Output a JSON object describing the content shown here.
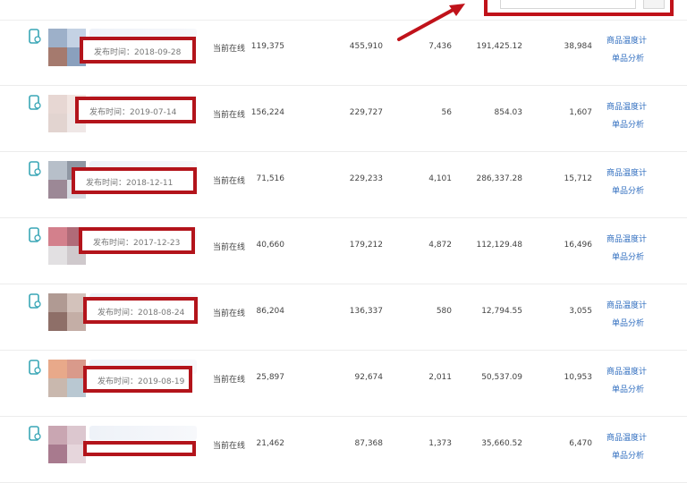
{
  "search": {
    "placeholder": "",
    "button_icon": "search-icon"
  },
  "colors": {
    "highlight": "#c0121a",
    "link": "#2f6dbf"
  },
  "rows": [
    {
      "date_label": "发布时间：2018-09-28",
      "status": "当前在线",
      "v1": "119,375",
      "v2": "455,910",
      "v3": "7,436",
      "v4": "191,425.12",
      "v5": "38,984",
      "link1": "商品温度计",
      "link2": "单品分析",
      "thumb": [
        "#9db0c9",
        "#c4d2e4",
        "#a57a6e",
        "#8aa0bd"
      ]
    },
    {
      "date_label": "发布时间：2019-07-14",
      "status": "当前在线",
      "v1": "156,224",
      "v2": "229,727",
      "v3": "56",
      "v4": "854.03",
      "v5": "1,607",
      "link1": "商品温度计",
      "link2": "单品分析",
      "thumb": [
        "#e7d7d3",
        "#f2e6e2",
        "#e2d4d0",
        "#efe7e6"
      ]
    },
    {
      "date_label": "发布时间：2018-12-11",
      "status": "当前在线",
      "v1": "71,516",
      "v2": "229,233",
      "v3": "4,101",
      "v4": "286,337.28",
      "v5": "15,712",
      "link1": "商品温度计",
      "link2": "单品分析",
      "thumb": [
        "#b7bfc9",
        "#8f97a3",
        "#9c8896",
        "#d8dbe2"
      ]
    },
    {
      "date_label": "发布时间：2017-12-23",
      "status": "当前在线",
      "v1": "40,660",
      "v2": "179,212",
      "v3": "4,872",
      "v4": "112,129.48",
      "v5": "16,496",
      "link1": "商品温度计",
      "link2": "单品分析",
      "thumb": [
        "#d3808c",
        "#b06b78",
        "#e2e0e2",
        "#cfc9cc"
      ]
    },
    {
      "date_label": "发布时间：2018-08-24",
      "status": "当前在线",
      "v1": "86,204",
      "v2": "136,337",
      "v3": "580",
      "v4": "12,794.55",
      "v5": "3,055",
      "link1": "商品温度计",
      "link2": "单品分析",
      "thumb": [
        "#b09a93",
        "#d3c2bb",
        "#8e6f68",
        "#c4aea6"
      ]
    },
    {
      "date_label": "发布时间：2019-08-19",
      "status": "当前在线",
      "v1": "25,897",
      "v2": "92,674",
      "v3": "2,011",
      "v4": "50,537.09",
      "v5": "10,953",
      "link1": "商品温度计",
      "link2": "单品分析",
      "thumb": [
        "#e8a98a",
        "#d99a8b",
        "#c9b8ae",
        "#b9c8d2"
      ]
    },
    {
      "date_label": "",
      "status": "当前在线",
      "v1": "21,462",
      "v2": "87,368",
      "v3": "1,373",
      "v4": "35,660.52",
      "v5": "6,470",
      "link1": "商品温度计",
      "link2": "单品分析",
      "thumb": [
        "#c9a6b2",
        "#dcc7cf",
        "#a87a8e",
        "#e6d6dc"
      ]
    }
  ]
}
